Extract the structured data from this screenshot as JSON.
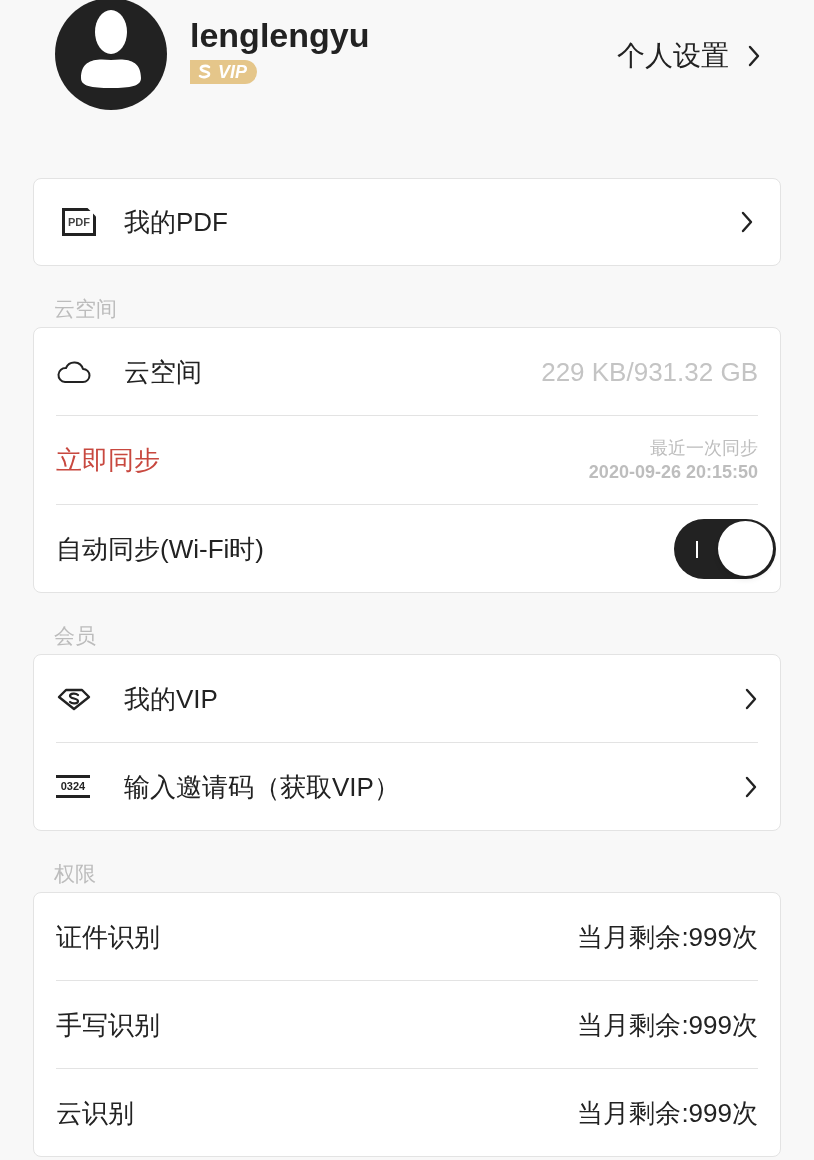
{
  "profile": {
    "username": "lenglengyu",
    "badge": "VIP",
    "settings_link": "个人设置"
  },
  "pdf_card": {
    "icon_text": "PDF",
    "label": "我的PDF"
  },
  "sections": [
    {
      "title": "云空间",
      "rows": [
        {
          "kind": "storage",
          "label": "云空间",
          "value": "229 KB/931.32 GB"
        },
        {
          "kind": "sync",
          "label": "立即同步",
          "caption": "最近一次同步",
          "time": "2020-09-26 20:15:50"
        },
        {
          "kind": "toggle",
          "label": "自动同步(Wi-Fi时)",
          "on": true
        }
      ]
    },
    {
      "title": "会员",
      "rows": [
        {
          "kind": "vip_link",
          "label": "我的VIP"
        },
        {
          "kind": "code_link",
          "icon_text": "0324",
          "label": "输入邀请码（获取VIP）"
        }
      ]
    },
    {
      "title": "权限",
      "rows": [
        {
          "kind": "quota",
          "label": "证件识别",
          "value": "当月剩余:999次"
        },
        {
          "kind": "quota",
          "label": "手写识别",
          "value": "当月剩余:999次"
        },
        {
          "kind": "quota",
          "label": "云识别",
          "value": "当月剩余:999次"
        }
      ]
    }
  ]
}
